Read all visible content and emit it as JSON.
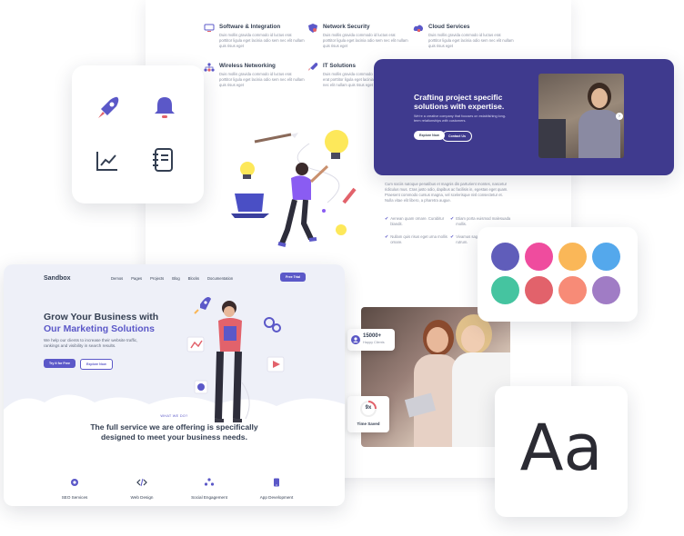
{
  "background_page": {
    "services": [
      {
        "title": "Software & Integration",
        "text": "Duis mollis gravida commodo id luctus erat porttitor ligula eget lacinia odio sem nec elit nullam quis risus eget",
        "icon": "monitor-icon"
      },
      {
        "title": "Network Security",
        "text": "Duis mollis gravida commodo id luctus erat porttitor ligula eget lacinia odio sem nec elit nullam quis risus eget",
        "icon": "shield-icon"
      },
      {
        "title": "Cloud Services",
        "text": "Duis mollis gravida commodo id luctus erat porttitor ligula eget lacinia odio sem nec elit nullam quis risus eget",
        "icon": "cloud-icon"
      },
      {
        "title": "Wireless Networking",
        "text": "Duis mollis gravida commodo id luctus erat porttitor ligula eget lacinia odio sem nec elit nullam quis risus eget",
        "icon": "network-icon"
      },
      {
        "title": "IT Solutions",
        "text": "Duis mollis gravida commodo id luctus erat porttitor ligula eget lacinia odio sem nec elit nullam quis risus eget",
        "icon": "rocket-icon"
      }
    ],
    "about_text": "Cum sociis natoque penatibus et magnis dis parturient montes, nascetur ridiculus mus. Cras justo odio, dapibus ac facilisis in, egestas eget quam. Praesent commodo cursus magna, vel scelerisque nisl consectetur et. Nulla vitae elit libero, a pharetra augue.",
    "checklist": [
      "Aenean quam ornare. Curabitur blandit.",
      "Etiam porta euismod malesuada mollis.",
      "Nullam quis risus eget urna mollis ornare.",
      "Vivamus sagittis lacus augue rutrum."
    ],
    "stat_clients_value": "15000+",
    "stat_clients_label": "Happy Clients",
    "stat_time_value": "9x",
    "stat_time_label": "Time Saved"
  },
  "banner": {
    "title_line1": "Crafting project specific",
    "title_line2": "solutions with expertise.",
    "text": "We're a creative company that focuses on establishing long-term relationships with customers.",
    "explore_label": "Explore Now",
    "contact_label": "Contact Us"
  },
  "icons_card": [
    "rocket-icon",
    "bell-icon",
    "chart-icon",
    "notebook-icon"
  ],
  "palette": {
    "colors": [
      "#605dba",
      "#ef4c9e",
      "#fab758",
      "#54a8ec",
      "#45c4a0",
      "#e2626b",
      "#f78b77",
      "#a07cc5"
    ]
  },
  "typography": {
    "sample": "Aa"
  },
  "main_site": {
    "brand": "Sandbox",
    "nav": [
      "Demos",
      "Pages",
      "Projects",
      "Blog",
      "Blocks",
      "Documentation"
    ],
    "free_trial": "Free Trial",
    "hero_title_line1": "Grow Your Business with",
    "hero_title_line2": "Our Marketing Solutions",
    "hero_text": "We help our clients to increase their website traffic, rankings and visibility in search results.",
    "try_free": "Try it for Free",
    "explore_now": "Explore Now",
    "section_label": "WHAT WE DO?",
    "section_title_line1": "The full service we are offering is specifically",
    "section_title_line2": "designed to meet your business needs.",
    "services": [
      {
        "label": "SEO Services",
        "icon": "seo-icon"
      },
      {
        "label": "Web Design",
        "icon": "code-icon"
      },
      {
        "label": "Social Engagement",
        "icon": "people-icon"
      },
      {
        "label": "App Development",
        "icon": "phone-icon"
      }
    ]
  },
  "colors": {
    "primary": "#5b58c8",
    "banner_bg": "#3f3a8e",
    "text_dark": "#343f52",
    "hero_bg": "#eef0f8"
  }
}
